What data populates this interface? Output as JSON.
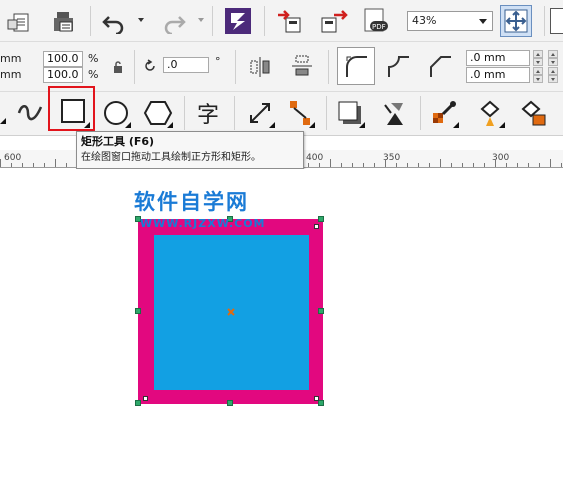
{
  "toolbar": {
    "zoom_level": "43%",
    "icons": [
      "import-icon",
      "export-icon",
      "undo-icon",
      "redo-icon",
      "application-launcher-icon",
      "publish-pdf-icon",
      "full-screen-icon"
    ]
  },
  "property_bar": {
    "width_unit": "mm",
    "height_unit": "mm",
    "scale_x": "100.0",
    "scale_y": "100.0",
    "percent_symbol": "%",
    "rotation": ".0",
    "degree_symbol": "°",
    "corner_radius_1": ".0 mm",
    "corner_radius_2": ".0 mm"
  },
  "toolbox": {
    "selected_tool": "rectangle-tool",
    "text_tool_glyph": "字"
  },
  "tooltip": {
    "title": "矩形工具 (F6)",
    "description": "在绘图窗口拖动工具绘制正方形和矩形。"
  },
  "ruler": {
    "labels": [
      "600",
      "400",
      "350",
      "300"
    ]
  },
  "watermark": {
    "main": "软件自学网",
    "sub": "WWW.RJZXW.COM"
  },
  "colors": {
    "outline": "#e2087f",
    "fill": "#12a0e3",
    "highlight": "#e2141c"
  }
}
